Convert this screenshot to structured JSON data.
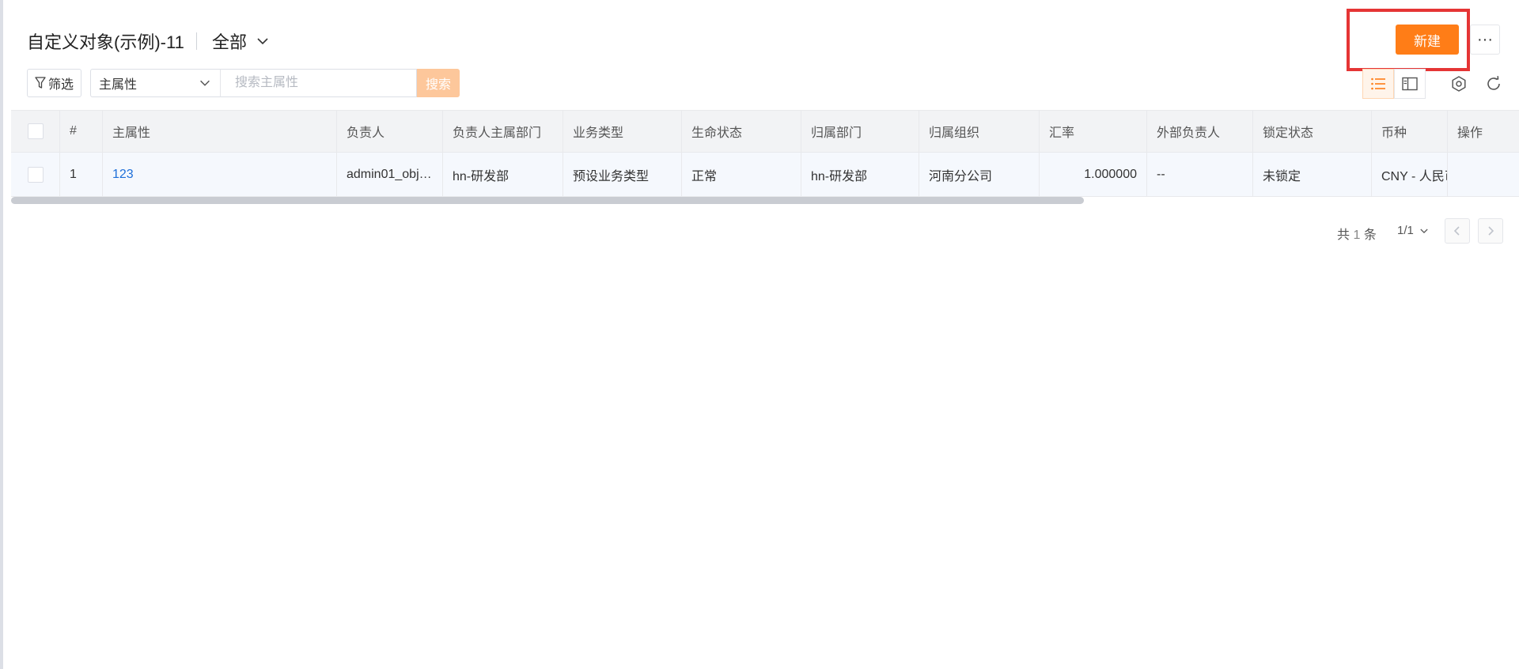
{
  "header": {
    "title": "自定义对象(示例)-11",
    "view_label": "全部",
    "new_button": "新建",
    "more_label": "···"
  },
  "toolbar": {
    "filter_label": "筛选",
    "field_select": "主属性",
    "search_placeholder": "搜索主属性",
    "search_button": "搜索"
  },
  "icons": {
    "filter": "funnel-icon",
    "chevron": "chevron-down-icon",
    "list_view": "list-view-icon",
    "split_view": "split-view-icon",
    "settings": "gear-icon",
    "refresh": "refresh-icon",
    "prev": "chevron-left-icon",
    "next": "chevron-right-icon"
  },
  "colors": {
    "accent": "#ff7d17",
    "accent_light": "#fdc79b",
    "highlight": "#e53535",
    "link": "#1e6fd9"
  },
  "table": {
    "columns": [
      "#",
      "主属性",
      "负责人",
      "负责人主属部门",
      "业务类型",
      "生命状态",
      "归属部门",
      "归属组织",
      "汇率",
      "外部负责人",
      "锁定状态",
      "币种",
      "操作"
    ],
    "rows": [
      {
        "index": "1",
        "main": "123",
        "owner": "admin01_obj…",
        "owner_dept": "hn-研发部",
        "biz_type": "预设业务类型",
        "life_status": "正常",
        "dept": "hn-研发部",
        "org": "河南分公司",
        "rate": "1.000000",
        "ext_owner": "--",
        "lock_status": "未锁定",
        "currency": "CNY - 人民币",
        "action": ""
      }
    ]
  },
  "pagination": {
    "total_prefix": "共",
    "total": "1",
    "total_suffix": "条",
    "page": "1/1"
  }
}
